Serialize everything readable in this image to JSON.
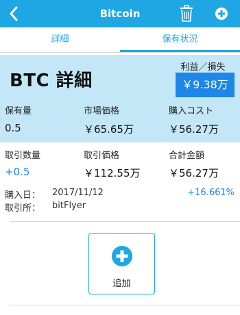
{
  "navbar": {
    "title": "Bitcoin",
    "back_icon": "chevron-left-icon",
    "trash_icon": "trash-icon",
    "add_icon": "plus-circle-icon",
    "color": "#1fa7e4"
  },
  "tabs": [
    {
      "label": "詳細",
      "active": false
    },
    {
      "label": "保有状況",
      "active": true
    }
  ],
  "summary": {
    "title": "BTC 詳細",
    "pl_label": "利益／損失",
    "pl_value": "￥9.38万",
    "background": "#c4e7f7",
    "accent": "#1e86e6"
  },
  "holdings": {
    "labels": [
      "保有量",
      "市場価格",
      "購入コスト"
    ],
    "values": [
      "0.5",
      "￥65.65万",
      "￥56.27万"
    ]
  },
  "trade": {
    "labels": [
      "取引数量",
      "取引価格",
      "合計金額"
    ],
    "values": [
      "+0.5",
      "￥112.55万",
      "￥56.27万"
    ]
  },
  "details": {
    "date_label": "購入日：",
    "date_value": "2017/11/12",
    "exchange_label": "取引所：",
    "exchange_value": "bitFlyer",
    "percent": "+16.661%"
  },
  "add_button": {
    "label": "追加",
    "icon": "plus-circle-icon"
  }
}
